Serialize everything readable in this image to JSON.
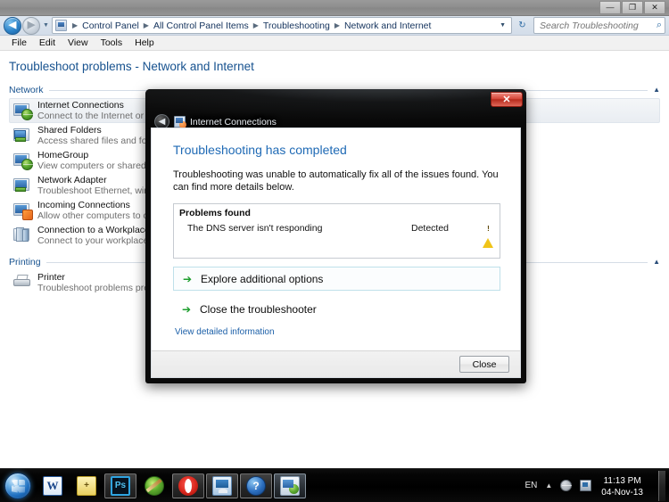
{
  "window": {
    "titlebar_buttons": [
      {
        "name": "minimize",
        "glyph": "—"
      },
      {
        "name": "maximize-restore",
        "glyph": "❐"
      },
      {
        "name": "close",
        "glyph": "✕"
      }
    ],
    "breadcrumbs": [
      "Control Panel",
      "All Control Panel Items",
      "Troubleshooting",
      "Network and Internet"
    ],
    "breadcrumb_separator": "▶",
    "address_dropdown_glyph": "▼",
    "refresh_glyph": "↻",
    "back_glyph": "◀",
    "forward_glyph": "▶",
    "history_glyph": "▼",
    "search": {
      "placeholder": "Search Troubleshooting",
      "value": "",
      "icon": "search-icon"
    },
    "menus": [
      "File",
      "Edit",
      "View",
      "Tools",
      "Help"
    ]
  },
  "page": {
    "title": "Troubleshoot problems - Network and Internet",
    "collapse_glyph": "▲",
    "groups": [
      {
        "label": "Network",
        "items": [
          {
            "name": "Internet Connections",
            "desc": "Connect to the Internet or to a ",
            "icon": "internet-connections-icon",
            "selected": true
          },
          {
            "name": "Shared Folders",
            "desc": "Access shared files and folders ",
            "icon": "shared-folders-icon",
            "selected": false
          },
          {
            "name": "HomeGroup",
            "desc": "View computers or shared files ",
            "icon": "homegroup-icon",
            "selected": false
          },
          {
            "name": "Network Adapter",
            "desc": "Troubleshoot Ethernet, wireless",
            "icon": "network-adapter-icon",
            "selected": false
          },
          {
            "name": "Incoming Connections",
            "desc": "Allow other computers to comm",
            "icon": "incoming-connections-icon",
            "selected": false
          },
          {
            "name": "Connection to a Workplace Usin",
            "desc": "Connect to your workplace netw",
            "icon": "workplace-connection-icon",
            "selected": false
          }
        ]
      },
      {
        "label": "Printing",
        "items": [
          {
            "name": "Printer",
            "desc": "Troubleshoot problems prevent",
            "icon": "printer-icon",
            "selected": false
          }
        ]
      }
    ]
  },
  "dialog": {
    "title": "Internet Connections",
    "app_icon": "internet-connections-icon",
    "back_glyph": "◀",
    "close_glyph": "✕",
    "heading": "Troubleshooting has completed",
    "paragraph": "Troubleshooting was unable to automatically fix all of the issues found. You can find more details below.",
    "problems": {
      "header": "Problems found",
      "rows": [
        {
          "name": "The DNS server isn't responding",
          "status": "Detected",
          "severity_icon": "warning-icon",
          "severity_glyph": "!"
        }
      ]
    },
    "actions": [
      {
        "label": "Explore additional options",
        "arrow": "➔",
        "highlighted": true
      },
      {
        "label": "Close the troubleshooter",
        "arrow": "➔",
        "highlighted": false
      }
    ],
    "detail_link": "View detailed information",
    "footer_button": "Close"
  },
  "taskbar": {
    "start_name": "start-orb",
    "tasks": [
      {
        "name": "task-word",
        "icon": "word-icon",
        "glyph": "W",
        "state": "normal"
      },
      {
        "name": "task-notes",
        "icon": "sticky-notes-icon",
        "glyph": "+",
        "state": "normal"
      },
      {
        "name": "task-photoshop",
        "icon": "photoshop-icon",
        "glyph": "Ps",
        "state": "active"
      },
      {
        "name": "task-paint",
        "icon": "paint-icon",
        "glyph": "",
        "state": "normal"
      },
      {
        "name": "task-opera",
        "icon": "opera-icon",
        "glyph": "",
        "state": "active"
      },
      {
        "name": "task-control-panel",
        "icon": "control-panel-icon",
        "glyph": "",
        "state": "active"
      },
      {
        "name": "task-help",
        "icon": "help-icon",
        "glyph": "?",
        "state": "active"
      },
      {
        "name": "task-troubleshooting",
        "icon": "troubleshooting-icon",
        "glyph": "",
        "state": "pressed"
      }
    ],
    "tray": {
      "language": "EN",
      "chevron": "▲",
      "network_icon": "network-icon",
      "volume_icon": "volume-icon",
      "time": "11:13 PM",
      "date": "04-Nov-13"
    }
  },
  "colors": {
    "accent_blue": "#17528f",
    "link_blue": "#1b5fa8",
    "heading_blue": "#1f6ab5",
    "warning_yellow": "#f0c419",
    "arrow_green": "#1d9e2e",
    "close_red": "#d7483a"
  }
}
